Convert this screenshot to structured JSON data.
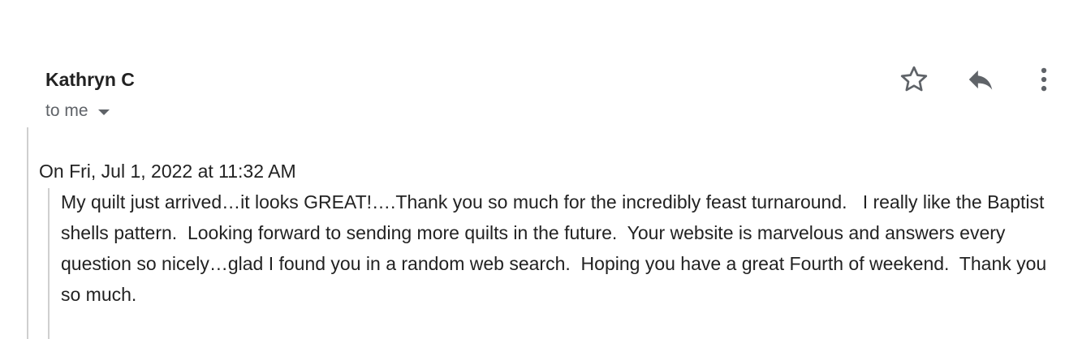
{
  "message": {
    "sender_name": "Kathryn C",
    "recipient_label": "to me",
    "icons": {
      "star": "star-outline-icon",
      "reply": "reply-icon",
      "more": "more-vertical-icon",
      "recipient_caret": "caret-down-icon"
    },
    "quote": {
      "attribution": "On Fri, Jul 1, 2022 at 11:32 AM",
      "body": "My quilt just arrived…it looks GREAT!….Thank you so much for the incredibly feast turnaround.   I really like the Baptist shells pattern.  Looking forward to sending more quilts in the future.  Your website is marvelous and answers every question so nicely…glad I found you in a random web search.  Hoping you have a great Fourth of weekend.  Thank you so much."
    }
  },
  "colors": {
    "text": "#222222",
    "secondary_text": "#5f6368",
    "icon": "#5f6368",
    "quote_border": "#cfcfcf",
    "background": "#ffffff"
  }
}
